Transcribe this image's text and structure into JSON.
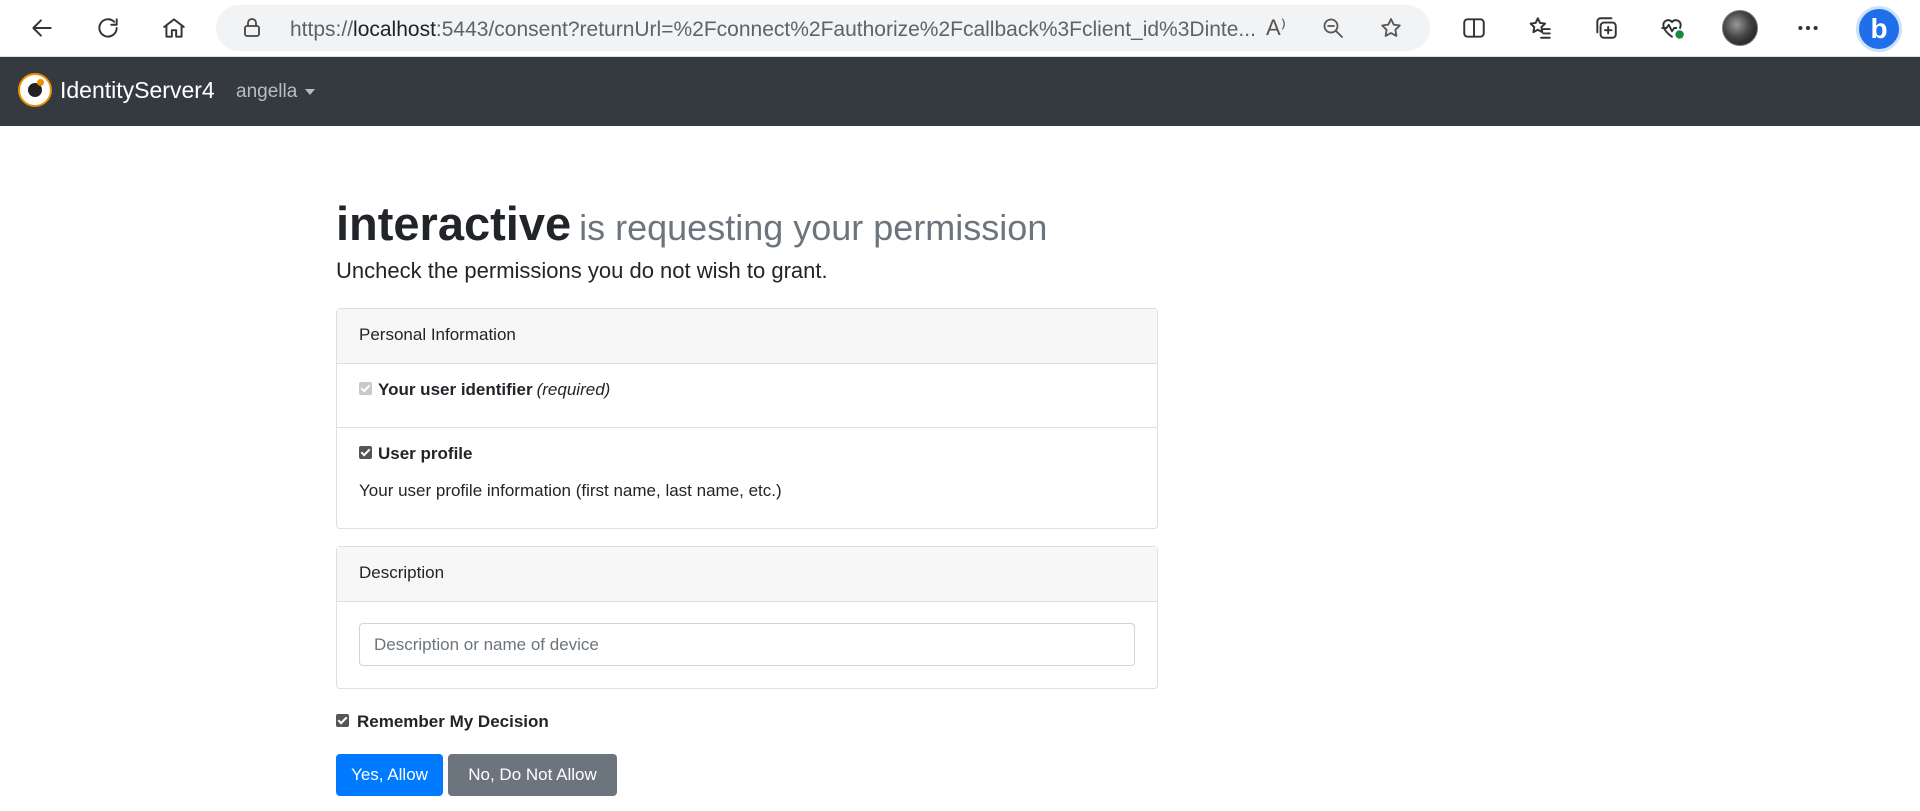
{
  "browser": {
    "url_prefix": "https://",
    "url_host": "localhost",
    "url_rest": ":5443/consent?returnUrl=%2Fconnect%2Fauthorize%2Fcallback%3Fclient_id%3Dinte...",
    "read_aloud_label": "A⁾"
  },
  "navbar": {
    "brand": "IdentityServer4",
    "user": "angella"
  },
  "page": {
    "client_name": "interactive",
    "request_text": "is requesting your permission",
    "lead": "Uncheck the permissions you do not wish to grant."
  },
  "personal_info": {
    "header": "Personal Information",
    "scopes": [
      {
        "label": "Your user identifier",
        "required_text": "(required)",
        "checked": true,
        "disabled": true
      },
      {
        "label": "User profile",
        "description": "Your user profile information (first name, last name, etc.)",
        "checked": true,
        "disabled": false
      }
    ]
  },
  "description": {
    "header": "Description",
    "placeholder": "Description or name of device",
    "value": ""
  },
  "remember": {
    "label": "Remember My Decision",
    "checked": true
  },
  "buttons": {
    "allow": "Yes, Allow",
    "deny": "No, Do Not Allow"
  },
  "colors": {
    "navbar": "#343a40",
    "primary": "#007bff",
    "secondary": "#6c757d"
  }
}
